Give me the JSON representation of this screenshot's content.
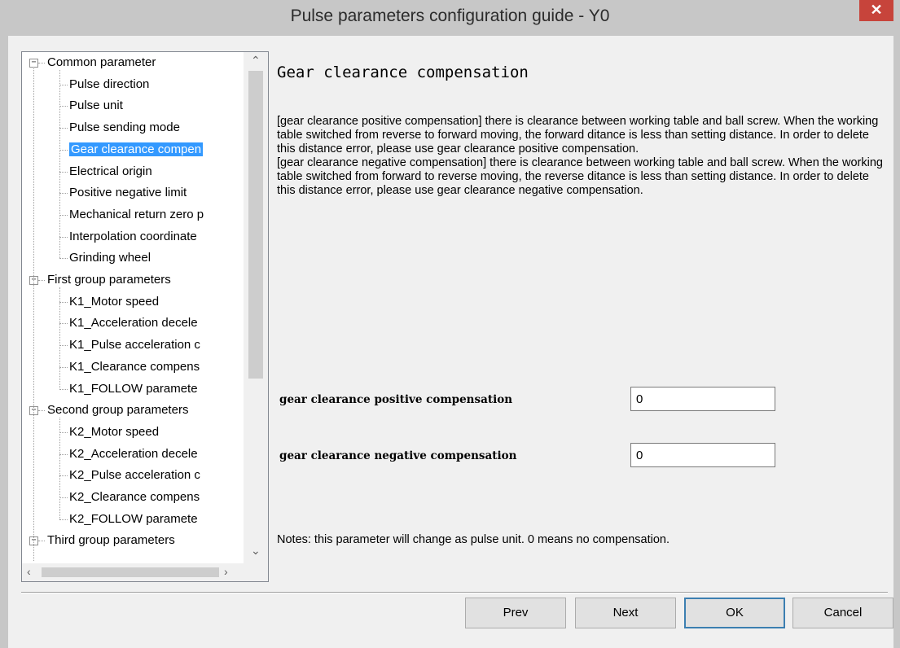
{
  "window": {
    "title": "Pulse parameters configuration guide - Y0",
    "close_glyph": "✕"
  },
  "tree": {
    "common_label": "Common parameter",
    "common_items": [
      "Pulse direction",
      "Pulse unit",
      "Pulse sending mode",
      "Gear clearance compen",
      "Electrical origin",
      "Positive negative limit",
      "Mechanical return zero p",
      "Interpolation coordinate",
      "Grinding wheel"
    ],
    "selected_index": 3,
    "first_label": "First group parameters",
    "first_items": [
      "K1_Motor speed",
      "K1_Acceleration decele",
      "K1_Pulse acceleration c",
      "K1_Clearance compens",
      "K1_FOLLOW paramete"
    ],
    "second_label": "Second group parameters",
    "second_items": [
      "K2_Motor speed",
      "K2_Acceleration decele",
      "K2_Pulse acceleration c",
      "K2_Clearance compens",
      "K2_FOLLOW paramete"
    ],
    "third_label": "Third group parameters",
    "expander_glyph": "−"
  },
  "content": {
    "heading": "Gear clearance compensation",
    "desc_positive": "[gear clearance positive compensation] there is clearance between working table and ball screw. When the working table switched from reverse to forward moving, the forward ditance is less than setting distance. In order to delete this distance error, please use gear clearance positive compensation.",
    "desc_negative": "[gear clearance negative compensation] there is clearance between working table and ball screw. When the working table switched from forward to reverse moving, the reverse ditance is less than setting distance. In order to delete this distance error, please use gear clearance negative compensation.",
    "positive_label": "gear clearance positive compensation",
    "positive_value": "0",
    "negative_label": "gear clearance negative compensation",
    "negative_value": "0",
    "notes": "Notes: this parameter will change as pulse unit. 0 means no compensation."
  },
  "buttons": {
    "prev": "Prev",
    "next": "Next",
    "ok": "OK",
    "cancel": "Cancel"
  },
  "colors": {
    "selection": "#3399ff",
    "close": "#c7443b"
  }
}
